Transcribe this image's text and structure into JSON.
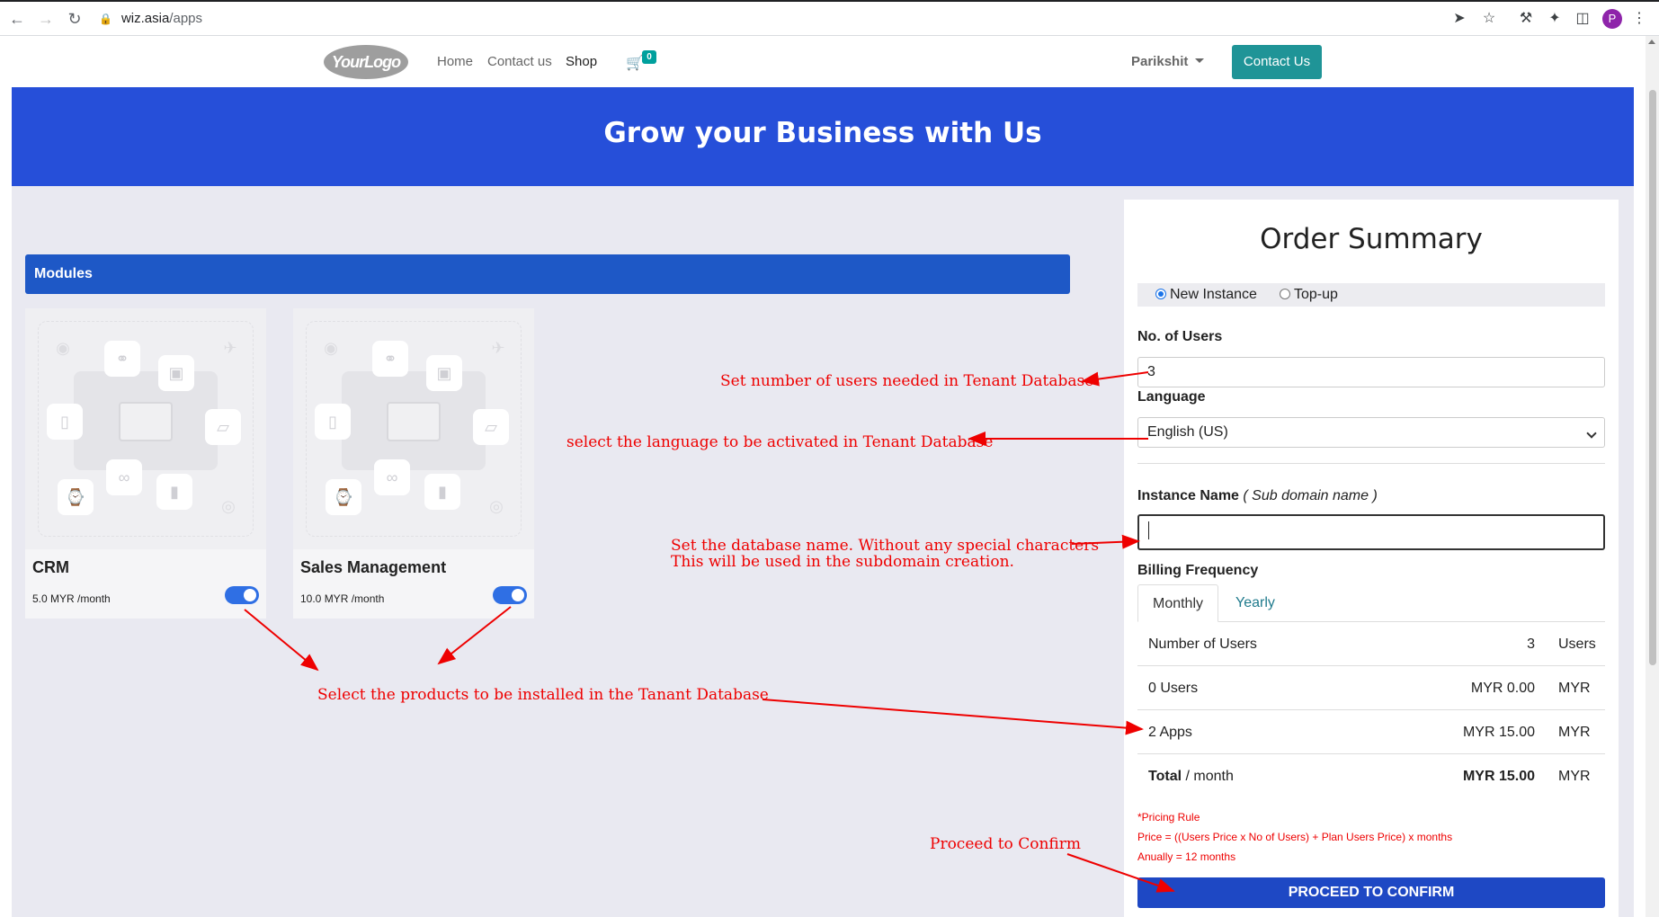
{
  "browser": {
    "url_host": "wiz.asia",
    "url_path": "/apps",
    "profile_initial": "P"
  },
  "header": {
    "logo": "YourLogo",
    "menu": [
      "Home",
      "Contact us",
      "Shop"
    ],
    "cart_count": "0",
    "user": "Parikshit",
    "contact_button": "Contact Us"
  },
  "hero": {
    "title": "Grow your Business with Us"
  },
  "modules": {
    "heading": "Modules",
    "items": [
      {
        "name": "CRM",
        "price": "5.0 MYR /month",
        "enabled": true
      },
      {
        "name": "Sales Management",
        "price": "10.0 MYR /month",
        "enabled": true
      }
    ]
  },
  "summary": {
    "title": "Order Summary",
    "instance_options": [
      "New Instance",
      "Top-up"
    ],
    "selected_option": "New Instance",
    "users_label": "No. of Users",
    "users_value": "3",
    "language_label": "Language",
    "language_value": "English (US)",
    "instance_label": "Instance Name",
    "instance_sub": "Sub domain name",
    "instance_value": "",
    "billing_label": "Billing Frequency",
    "billing_tabs": [
      "Monthly",
      "Yearly"
    ],
    "rows": [
      {
        "label": "Number of Users",
        "value": "3",
        "unit": "Users"
      },
      {
        "label": "0 Users",
        "value": "MYR 0.00",
        "unit": "MYR"
      },
      {
        "label": "2 Apps",
        "value": "MYR 15.00",
        "unit": "MYR"
      }
    ],
    "total": {
      "label": "Total",
      "label_suffix": " / month",
      "value": "MYR 15.00",
      "unit": "MYR"
    },
    "pricing_rule": [
      "*Pricing Rule",
      "Price = ((Users Price x No of Users) + Plan Users Price) x months",
      "Anually = 12 months"
    ],
    "proceed_button": "PROCEED TO CONFIRM"
  },
  "annotations": {
    "users": "Set number of users needed in Tenant Database",
    "language": "select the language to be activated in Tenant Database",
    "dbname_1": "Set the database name. Without any special characters",
    "dbname_2": "This will be used in the subdomain creation.",
    "products": "Select the products to be installed in the Tanant Database",
    "proceed": "Proceed to Confirm"
  },
  "colors": {
    "hero": "#264fd9",
    "modules_bar": "#1e58c6",
    "contact_button": "#1f9497",
    "toggle": "#2f6fe4",
    "proceed": "#1e48c4",
    "annotation": "#ee0000"
  }
}
